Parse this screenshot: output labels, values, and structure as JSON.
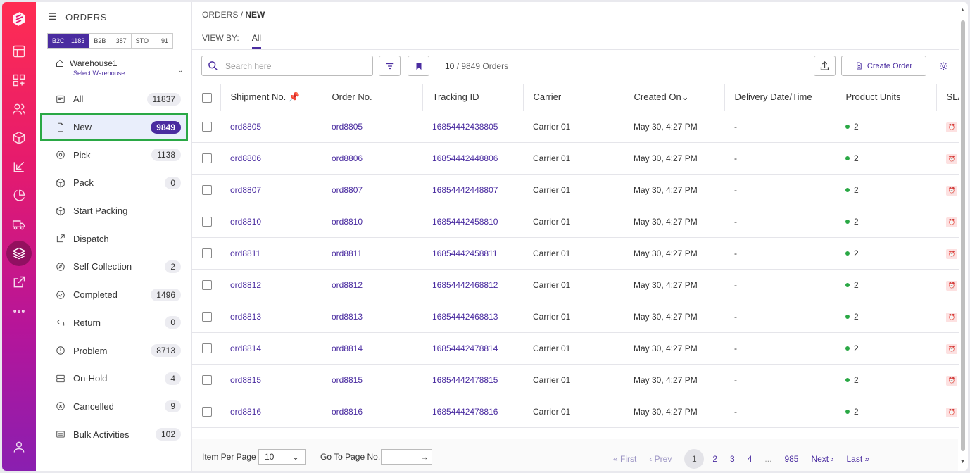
{
  "header": {
    "title": "ORDERS"
  },
  "channels": [
    {
      "label": "B2C",
      "count": "1183"
    },
    {
      "label": "B2B",
      "count": "387"
    },
    {
      "label": "STO",
      "count": "91"
    }
  ],
  "warehouse": {
    "name": "Warehouse1",
    "sub": "Select Warehouse"
  },
  "menu": [
    {
      "label": "All",
      "count": "11837"
    },
    {
      "label": "New",
      "count": "9849"
    },
    {
      "label": "Pick",
      "count": "1138"
    },
    {
      "label": "Pack",
      "count": "0"
    },
    {
      "label": "Start Packing",
      "count": ""
    },
    {
      "label": "Dispatch",
      "count": ""
    },
    {
      "label": "Self Collection",
      "count": "2"
    },
    {
      "label": "Completed",
      "count": "1496"
    },
    {
      "label": "Return",
      "count": "0"
    },
    {
      "label": "Problem",
      "count": "8713"
    },
    {
      "label": "On-Hold",
      "count": "4"
    },
    {
      "label": "Cancelled",
      "count": "9"
    },
    {
      "label": "Bulk Activities",
      "count": "102"
    }
  ],
  "breadcrumb": {
    "root": "ORDERS",
    "sep": "/",
    "current": "NEW"
  },
  "viewby": {
    "label": "VIEW BY:",
    "value": "All"
  },
  "search": {
    "placeholder": "Search here"
  },
  "count": {
    "shown": "10",
    "rest": " / 9849 Orders"
  },
  "create_label": "Create Order",
  "columns": [
    "Shipment No.",
    "Order No.",
    "Tracking ID",
    "Carrier",
    "Created On",
    "Delivery Date/Time",
    "Product Units",
    "SLA"
  ],
  "rows": [
    {
      "shipment": "ord8805",
      "order": "ord8805",
      "tracking": "16854442438805",
      "carrier": "Carrier 01",
      "created": "May 30, 4:27 PM",
      "delivery": "-",
      "units": "2"
    },
    {
      "shipment": "ord8806",
      "order": "ord8806",
      "tracking": "16854442448806",
      "carrier": "Carrier 01",
      "created": "May 30, 4:27 PM",
      "delivery": "-",
      "units": "2"
    },
    {
      "shipment": "ord8807",
      "order": "ord8807",
      "tracking": "16854442448807",
      "carrier": "Carrier 01",
      "created": "May 30, 4:27 PM",
      "delivery": "-",
      "units": "2"
    },
    {
      "shipment": "ord8810",
      "order": "ord8810",
      "tracking": "16854442458810",
      "carrier": "Carrier 01",
      "created": "May 30, 4:27 PM",
      "delivery": "-",
      "units": "2"
    },
    {
      "shipment": "ord8811",
      "order": "ord8811",
      "tracking": "16854442458811",
      "carrier": "Carrier 01",
      "created": "May 30, 4:27 PM",
      "delivery": "-",
      "units": "2"
    },
    {
      "shipment": "ord8812",
      "order": "ord8812",
      "tracking": "16854442468812",
      "carrier": "Carrier 01",
      "created": "May 30, 4:27 PM",
      "delivery": "-",
      "units": "2"
    },
    {
      "shipment": "ord8813",
      "order": "ord8813",
      "tracking": "16854442468813",
      "carrier": "Carrier 01",
      "created": "May 30, 4:27 PM",
      "delivery": "-",
      "units": "2"
    },
    {
      "shipment": "ord8814",
      "order": "ord8814",
      "tracking": "16854442478814",
      "carrier": "Carrier 01",
      "created": "May 30, 4:27 PM",
      "delivery": "-",
      "units": "2"
    },
    {
      "shipment": "ord8815",
      "order": "ord8815",
      "tracking": "16854442478815",
      "carrier": "Carrier 01",
      "created": "May 30, 4:27 PM",
      "delivery": "-",
      "units": "2"
    },
    {
      "shipment": "ord8816",
      "order": "ord8816",
      "tracking": "16854442478816",
      "carrier": "Carrier 01",
      "created": "May 30, 4:27 PM",
      "delivery": "-",
      "units": "2"
    }
  ],
  "footer": {
    "items_per_page_label": "Item Per Page",
    "items_per_page": "10",
    "goto_label": "Go To Page No.",
    "first": "« First",
    "prev": "‹ Prev",
    "pages": [
      "1",
      "2",
      "3",
      "4"
    ],
    "ellipsis": "...",
    "last_page": "985",
    "next": "Next ›",
    "last": "Last »"
  },
  "colors": {
    "accent": "#4a2ca0",
    "selected_outline": "#2aa845",
    "status_dot": "#2aa845"
  }
}
